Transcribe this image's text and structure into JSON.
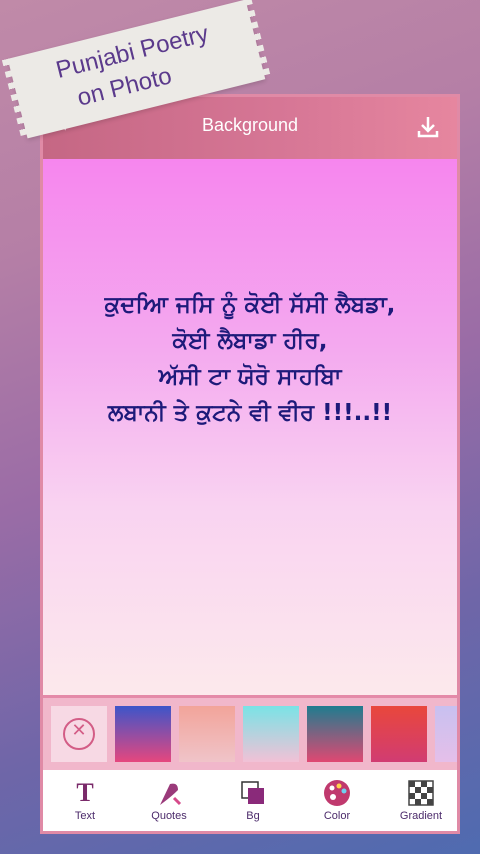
{
  "banner": {
    "line1": "Punjabi Poetry",
    "line2": "on Photo"
  },
  "header": {
    "title": "Background",
    "back_icon": "chevron-left-icon",
    "download_icon": "download-icon"
  },
  "poem": {
    "lines": [
      "ਕੁਦਆਿ ਜਸਿ ਨੂੰ ਕੋਈ ਸੱਸੀ ਲੈਬਡਾ,",
      "ਕੋਈ ਲੈਬਾਡਾ ਹੀਰ,",
      "ਅੱਸੀ ਟਾ ਯੋਰੋ ਸਾਹਬਿਾ",
      "ਲਬਾਨੀ ਤੇ ਕੁਟਨੇ ਵੀ ਵੀਰ !!!..!!"
    ],
    "color": "#1d1a7a"
  },
  "swatches": [
    {
      "from": "#3d55c9",
      "to": "#e6477e"
    },
    {
      "from": "#f2a49a",
      "to": "#f0c4c9"
    },
    {
      "from": "#7ae3e6",
      "to": "#f2c1d6"
    },
    {
      "from": "#1f7c8f",
      "to": "#e04872"
    },
    {
      "from": "#e9473c",
      "to": "#d13c72"
    },
    {
      "from": "#c8c0f0",
      "to": "#e5bfe9"
    }
  ],
  "toolbar": {
    "items": [
      {
        "label": "Text",
        "icon": "text-icon"
      },
      {
        "label": "Quotes",
        "icon": "quill-icon"
      },
      {
        "label": "Bg",
        "icon": "layers-icon"
      },
      {
        "label": "Color",
        "icon": "palette-icon"
      },
      {
        "label": "Gradient",
        "icon": "checker-icon"
      }
    ]
  }
}
